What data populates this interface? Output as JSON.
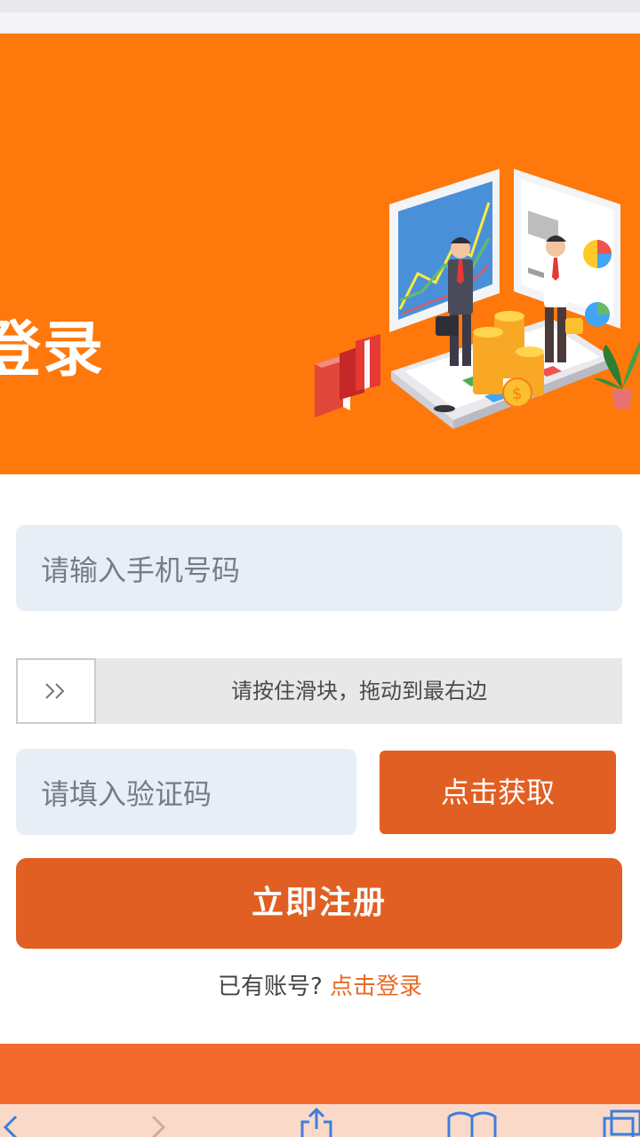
{
  "hero": {
    "title": "登录"
  },
  "form": {
    "phone_placeholder": "请输入手机号码",
    "slider_hint": "请按住滑块，拖动到最右边",
    "slider_handle_icon": "double-chevron-right-icon",
    "code_placeholder": "请填入验证码",
    "get_code_label": "点击获取",
    "register_label": "立即注册",
    "has_account_text": "已有账号?",
    "login_link_text": "点击登录"
  },
  "toolbar": {
    "icons": [
      "back-icon",
      "forward-icon",
      "share-icon",
      "bookmarks-icon",
      "tabs-icon"
    ]
  },
  "colors": {
    "hero_bg": "#fe780c",
    "accent": "#e15f22",
    "field_bg": "#e8eef6",
    "link": "#e96a24"
  }
}
